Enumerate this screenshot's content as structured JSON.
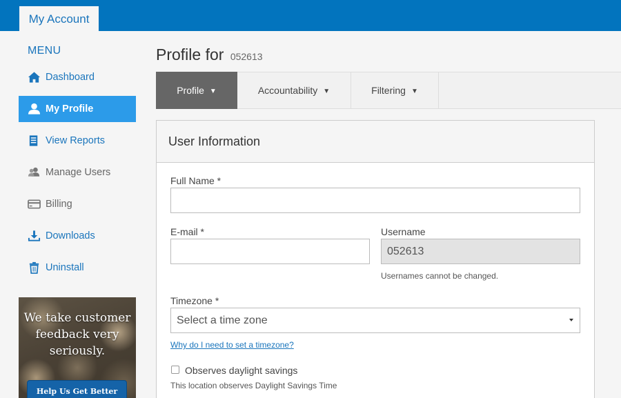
{
  "topbar": {
    "tab_label": "My Account",
    "color": "#0274be"
  },
  "menu": {
    "title": "MENU",
    "items": [
      {
        "label": "Dashboard",
        "icon": "home-icon"
      },
      {
        "label": "My Profile",
        "icon": "user-icon"
      },
      {
        "label": "View Reports",
        "icon": "report-icon"
      },
      {
        "label": "Manage Users",
        "icon": "users-icon"
      },
      {
        "label": "Billing",
        "icon": "credit-card-icon"
      },
      {
        "label": "Downloads",
        "icon": "download-icon"
      },
      {
        "label": "Uninstall",
        "icon": "trash-icon"
      }
    ],
    "active_color": "#2c9be9"
  },
  "promo": {
    "text": "We take customer feedback very seriously.",
    "button": "Help Us Get Better"
  },
  "page": {
    "title": "Profile for",
    "username": "052613"
  },
  "tabs": [
    {
      "label": "Profile",
      "caret": "▼"
    },
    {
      "label": "Accountability",
      "caret": "▼"
    },
    {
      "label": "Filtering",
      "caret": "▼"
    }
  ],
  "panel": {
    "heading": "User Information",
    "full_name": {
      "label": "Full Name *",
      "value": ""
    },
    "email": {
      "label": "E-mail *",
      "value": ""
    },
    "username": {
      "label": "Username",
      "value": "052613",
      "help": "Usernames cannot be changed."
    },
    "timezone": {
      "label": "Timezone *",
      "value": "Select a time zone",
      "link": "Why do I need to set a timezone?"
    },
    "dst": {
      "label": "Observes daylight savings",
      "help": "This location observes Daylight Savings Time"
    }
  }
}
